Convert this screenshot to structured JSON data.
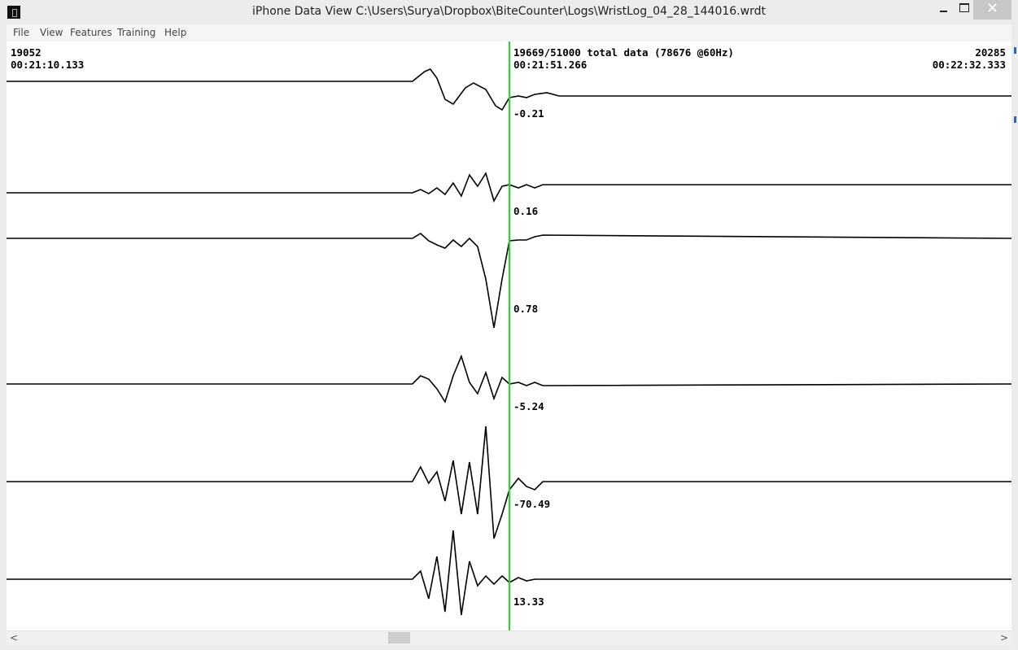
{
  "window": {
    "title": "iPhone Data View   C:\\Users\\Surya\\Dropbox\\BiteCounter\\Logs\\WristLog_04_28_144016.wrdt",
    "minimize": "–",
    "close": "✕"
  },
  "menu": [
    "File",
    "View",
    "Features",
    "Training",
    "Help"
  ],
  "readouts": {
    "left_index": "19052",
    "left_time": "00:21:10.133",
    "center_info": "19669/51000 total data (78676 @60Hz)",
    "center_time": "00:21:51.266",
    "right_index": "20285",
    "right_time": "00:22:32.333"
  },
  "channel_values": [
    "-0.21",
    "0.16",
    "0.78",
    "-5.24",
    "-70.49",
    "13.33"
  ],
  "colors": {
    "cursor": "#22dd22",
    "trace": "#000000",
    "background": "#ffffff"
  },
  "chart_data": {
    "type": "line",
    "x_range": [
      19052,
      20285
    ],
    "cursor_x": 19669,
    "series": [
      {
        "value": "-0.21",
        "x": [
          19052,
          19550,
          19565,
          19572,
          19580,
          19590,
          19600,
          19615,
          19625,
          19640,
          19652,
          19660,
          19669,
          19680,
          19690,
          19700,
          19715,
          19730,
          20285
        ],
        "y": [
          0,
          0,
          12,
          15,
          4,
          -22,
          -28,
          -8,
          -2,
          -10,
          -30,
          -35,
          -20,
          -18,
          -20,
          -16,
          -14,
          -18,
          -18
        ]
      },
      {
        "value": "0.16",
        "x": [
          19052,
          19550,
          19560,
          19570,
          19580,
          19590,
          19600,
          19610,
          19620,
          19630,
          19640,
          19650,
          19660,
          19669,
          19680,
          19690,
          19700,
          19710,
          20285
        ],
        "y": [
          0,
          0,
          4,
          -1,
          6,
          -2,
          12,
          -4,
          22,
          8,
          24,
          -10,
          8,
          10,
          6,
          10,
          6,
          10,
          10
        ]
      },
      {
        "value": "0.78",
        "x": [
          19052,
          19550,
          19560,
          19570,
          19580,
          19590,
          19600,
          19610,
          19620,
          19630,
          19640,
          19650,
          19660,
          19669,
          19680,
          19690,
          19700,
          19710,
          20285
        ],
        "y": [
          0,
          0,
          6,
          -3,
          -8,
          -12,
          -2,
          -10,
          0,
          -10,
          -50,
          -110,
          -50,
          -3,
          -2,
          -2,
          2,
          4,
          0
        ]
      },
      {
        "value": "-5.24",
        "x": [
          19052,
          19550,
          19560,
          19570,
          19580,
          19590,
          19600,
          19610,
          19620,
          19630,
          19640,
          19650,
          19660,
          19669,
          19680,
          19690,
          19700,
          19710,
          20285
        ],
        "y": [
          0,
          0,
          10,
          6,
          -6,
          -22,
          10,
          34,
          2,
          -12,
          14,
          -18,
          8,
          0,
          2,
          -2,
          2,
          -2,
          0
        ]
      },
      {
        "value": "-70.49",
        "x": [
          19052,
          19550,
          19560,
          19570,
          19580,
          19590,
          19600,
          19610,
          19620,
          19630,
          19640,
          19650,
          19660,
          19669,
          19680,
          19690,
          19700,
          19710,
          20285
        ],
        "y": [
          0,
          0,
          18,
          -2,
          12,
          -24,
          26,
          -40,
          24,
          -40,
          68,
          -70,
          -40,
          -10,
          4,
          -6,
          -10,
          0,
          0
        ]
      },
      {
        "value": "13.33",
        "x": [
          19052,
          19550,
          19560,
          19570,
          19580,
          19590,
          19600,
          19610,
          19620,
          19630,
          19640,
          19650,
          19660,
          19669,
          19680,
          19690,
          19700,
          19710,
          20285
        ],
        "y": [
          0,
          0,
          10,
          -24,
          28,
          -40,
          60,
          -44,
          22,
          -8,
          4,
          -6,
          4,
          -4,
          2,
          -2,
          0,
          0,
          0
        ]
      }
    ]
  }
}
